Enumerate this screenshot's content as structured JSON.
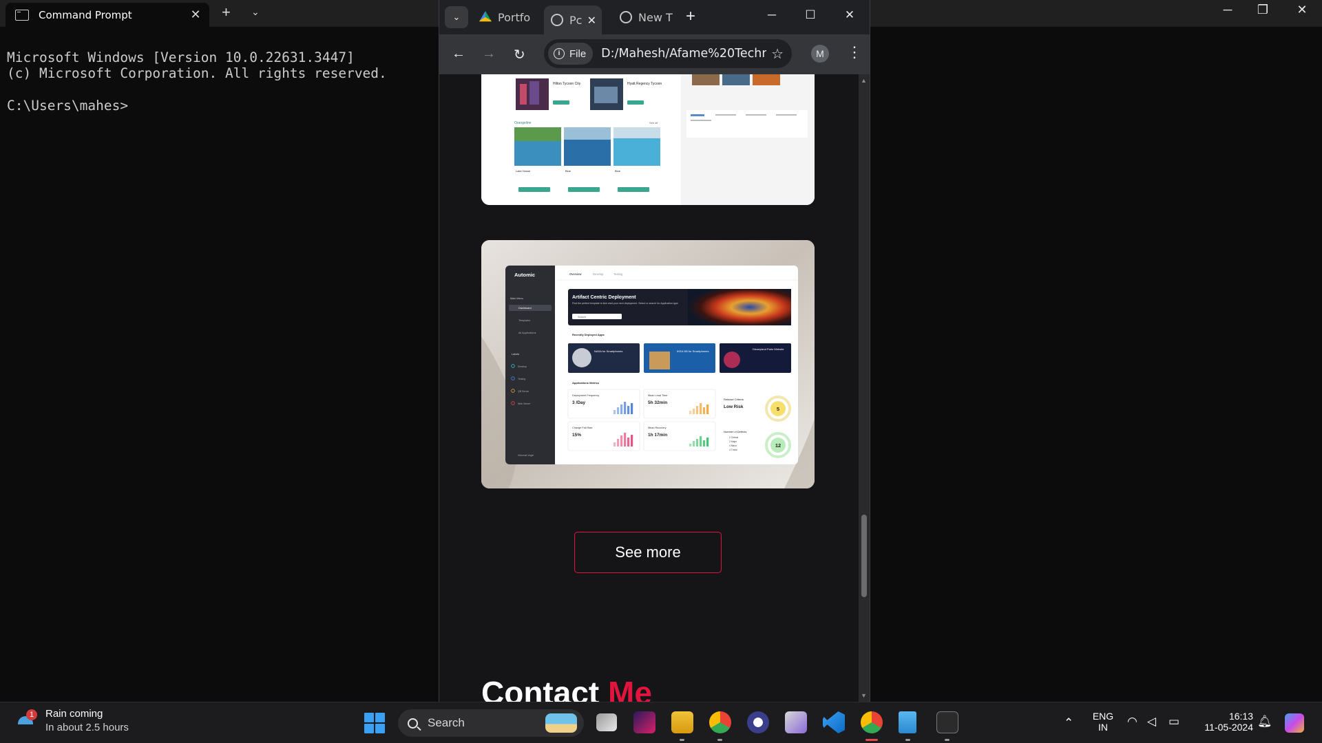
{
  "terminal": {
    "tab_title": "Command Prompt",
    "lines": [
      "Microsoft Windows [Version 10.0.22631.3447]",
      "(c) Microsoft Corporation. All rights reserved.",
      "",
      "C:\\Users\\mahes>"
    ]
  },
  "browser": {
    "tabs": [
      {
        "label": "Portfo",
        "icon": "google-drive-icon"
      },
      {
        "label": "Pc",
        "icon": "globe-icon"
      },
      {
        "label": "New T",
        "icon": "chrome-icon"
      }
    ],
    "address_chip": "File",
    "url": "D:/Mahesh/Afame%20Techn...",
    "profile_initial": "M"
  },
  "page": {
    "card1": {
      "section_label": "Orangeline",
      "see_all": "See all",
      "hotels": [
        "Hilton Tycoon City",
        "Hyatt Regency Tycoon"
      ],
      "listings": [
        "Lake House",
        "Blue",
        "Blue"
      ],
      "button": "Book now"
    },
    "card2": {
      "brand": "Automic",
      "nav_tabs": [
        "Overview",
        "Develop",
        "Testing"
      ],
      "sidebar_heading": "Main Menu",
      "sidebar_items": [
        "Dashboard",
        "Templates",
        "All Applications"
      ],
      "labels_heading": "Labels",
      "labels": [
        "Develop",
        "Testing",
        "QB Server",
        "Web Server"
      ],
      "hero_title": "Artifact Centric Deployment",
      "hero_sub": "Find the perfect template to kick start your next deployment. Select or search for Application type.",
      "search_placeholder": "Search",
      "recent_heading": "Recently Deployed Apps",
      "apps": [
        {
          "title": "NASA for Smartphones",
          "colors": [
            "#1f2a44",
            "#3b4f7a"
          ]
        },
        {
          "title": "IKEA GB for Smartphones",
          "colors": [
            "#1b5fa8",
            "#2c7fd4"
          ]
        },
        {
          "title": "Disneyland Paris Website",
          "colors": [
            "#141a3a",
            "#7a1a3d"
          ]
        }
      ],
      "metrics_heading": "Applications Metrics",
      "metrics": [
        {
          "label": "Deployment Frequency",
          "value": "3 /Day",
          "color": "#4a7fd6"
        },
        {
          "label": "Mean Lead Time",
          "value": "5h 32min",
          "color": "#f0a53a"
        },
        {
          "label": "Change Fail Rate",
          "value": "15%",
          "color": "#e44d7b"
        },
        {
          "label": "Mean Recovery",
          "value": "1h 17min",
          "color": "#3bbf6a"
        }
      ],
      "release_label": "Release Criteria",
      "release_value": "Low Risk",
      "release_score": "5",
      "defects_label": "Number of Defects",
      "defects_list": [
        "2 Critical",
        "2 Major",
        "4 Minor",
        "4 Trivial"
      ],
      "defects_score": "12",
      "sidebar_footer": "Vkkonok Vogel"
    },
    "see_more": "See more",
    "contact_heading": "Contact",
    "contact_accent": "Me"
  },
  "taskbar": {
    "weather_line1": "Rain coming",
    "weather_line2": "In about 2.5 hours",
    "weather_badge": "1",
    "search_placeholder": "Search",
    "lang_line1": "ENG",
    "lang_line2": "IN",
    "time": "16:13",
    "date": "11-05-2024"
  },
  "colors": {
    "accent_red": "#e0143c",
    "terminal_bg": "#0c0c0c",
    "browser_bg": "#151416"
  }
}
